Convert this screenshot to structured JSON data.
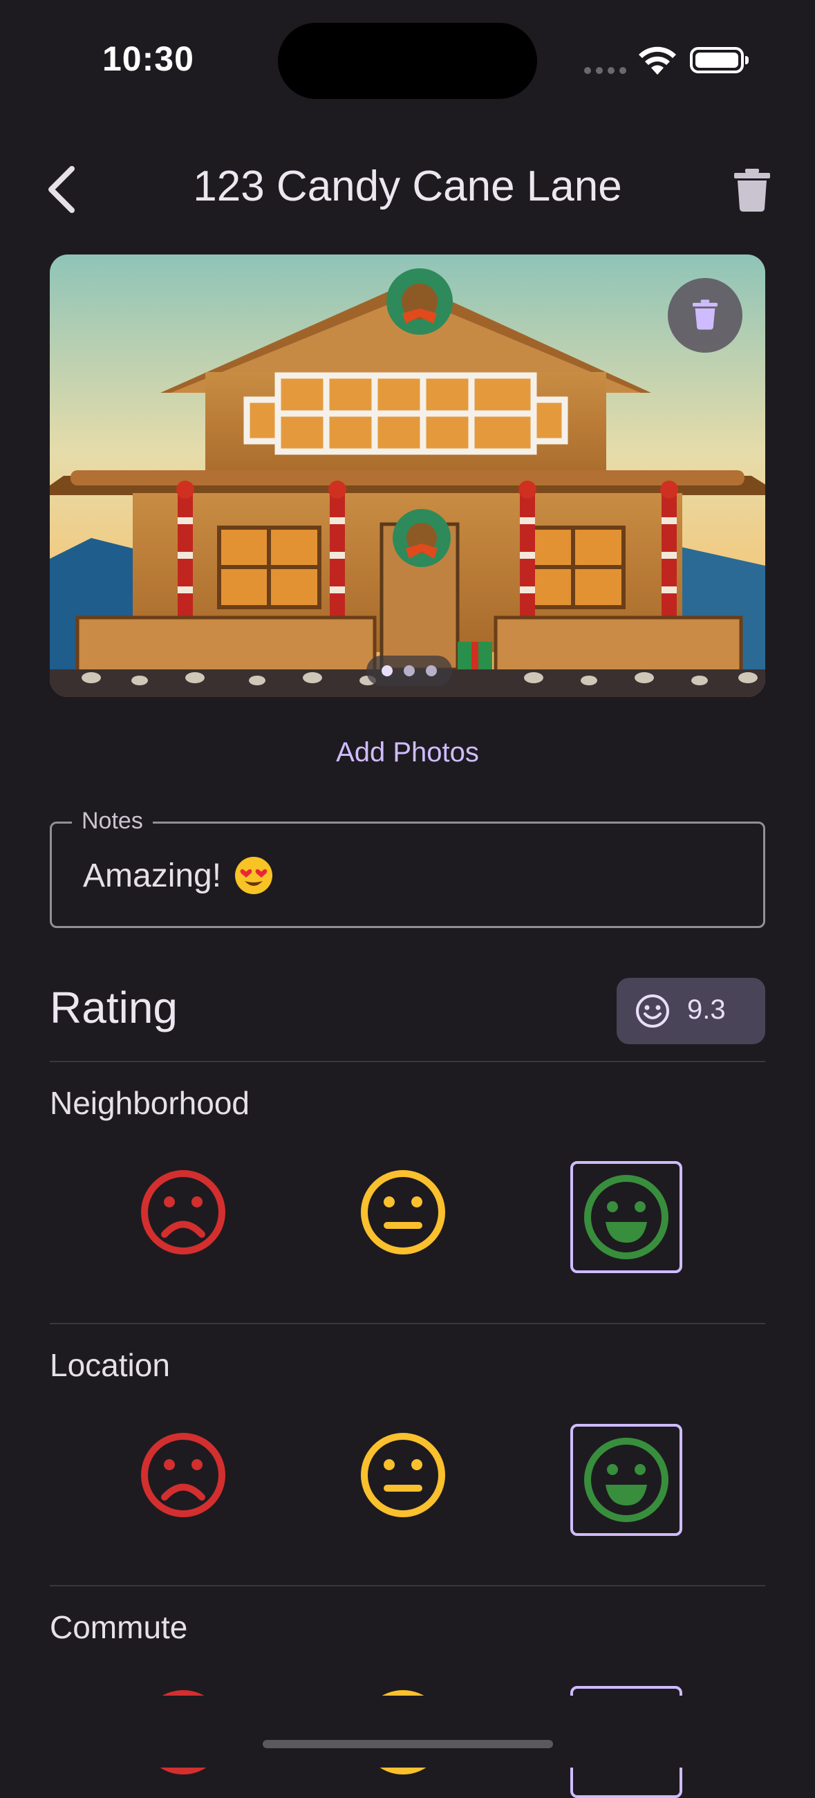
{
  "status_bar": {
    "time": "10:30"
  },
  "header": {
    "title": "123 Candy Cane Lane"
  },
  "photos": {
    "page_index": 1,
    "page_count": 3
  },
  "add_photos_label": "Add Photos",
  "notes": {
    "label": "Notes",
    "value": "Amazing!"
  },
  "rating": {
    "title": "Rating",
    "score": "9.3",
    "categories": [
      {
        "label": "Neighborhood",
        "selected": "good"
      },
      {
        "label": "Location",
        "selected": "good"
      },
      {
        "label": "Commute",
        "selected": "good"
      }
    ]
  },
  "colors": {
    "background": "#1d1b20",
    "accent": "#d0bcff",
    "bad": "#d32f2f",
    "neutral": "#fbc02d",
    "good": "#388e3c"
  }
}
